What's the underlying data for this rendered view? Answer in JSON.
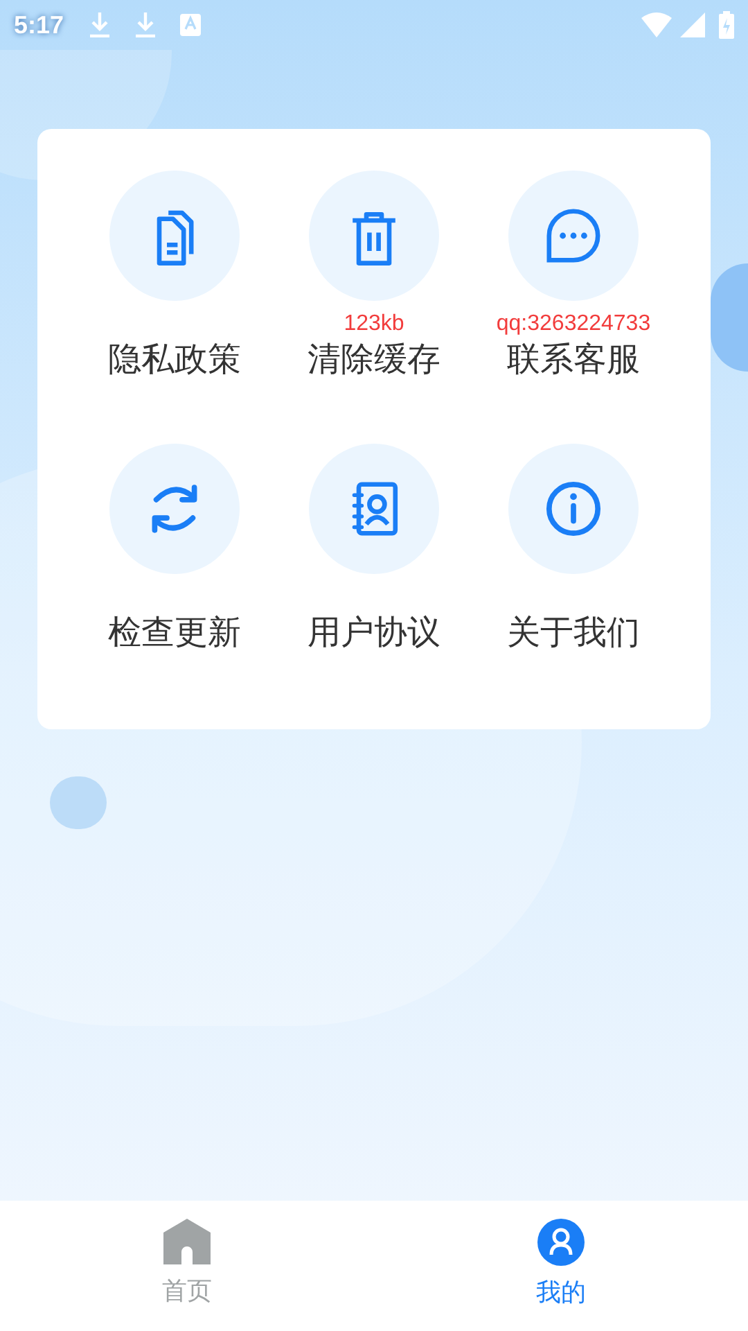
{
  "status_bar": {
    "time": "5:17"
  },
  "menu": [
    {
      "kind": "docs",
      "label": "隐私政策"
    },
    {
      "kind": "trash",
      "label": "清除缓存",
      "note": "123kb"
    },
    {
      "kind": "chat",
      "label": "联系客服",
      "note": "qq:3263224733"
    },
    {
      "kind": "refresh",
      "label": "检查更新"
    },
    {
      "kind": "contacts",
      "label": "用户协议"
    },
    {
      "kind": "info",
      "label": "关于我们"
    }
  ],
  "tabs": [
    {
      "kind": "home",
      "label": "首页",
      "selected": false
    },
    {
      "kind": "me",
      "label": "我的",
      "selected": true
    }
  ]
}
